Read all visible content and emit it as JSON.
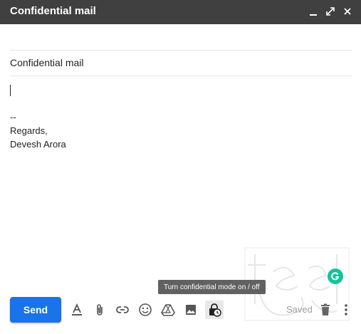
{
  "window": {
    "title": "Confidential mail",
    "controls": [
      "minimize-icon",
      "expand-icon",
      "close-icon"
    ]
  },
  "subject": {
    "value": "Confidential mail"
  },
  "body": {
    "signature_lines": [
      "--",
      "Regards,",
      "Devesh Arora"
    ]
  },
  "toolbar": {
    "send_label": "Send",
    "icons": [
      "format-text-icon",
      "attach-icon",
      "link-icon",
      "emoji-icon",
      "drive-icon",
      "photo-icon",
      "confidential-mode-icon"
    ],
    "tooltip": "Turn confidential mode on / off",
    "saved_label": "Saved",
    "right_icons": [
      "delete-icon",
      "more-options-icon"
    ]
  },
  "colors": {
    "title_bar": "#404040",
    "send_button": "#1a73e8",
    "grammarly": "#15c39a",
    "tooltip_bg": "#616161"
  }
}
